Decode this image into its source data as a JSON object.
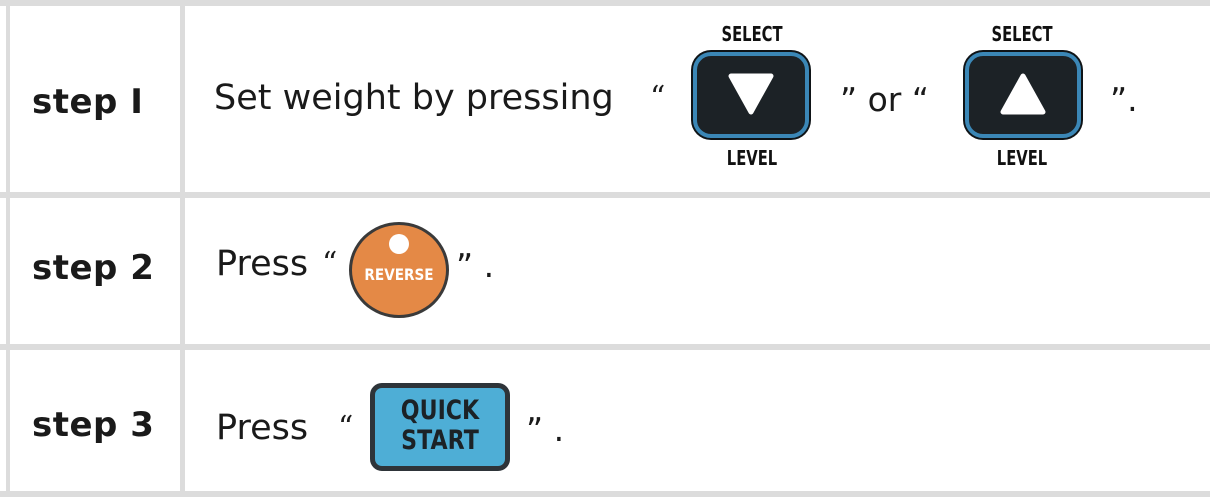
{
  "steps": [
    {
      "label": "step I",
      "text_before": "Set weight by pressing",
      "open_quote_1": "“",
      "close_quote_or": "” or “",
      "close_quote_end": "”.",
      "key_down": {
        "top_caption": "SELECT",
        "bottom_caption": "LEVEL",
        "icon": "triangle-down-icon"
      },
      "key_up": {
        "top_caption": "SELECT",
        "bottom_caption": "LEVEL",
        "icon": "triangle-up-icon"
      }
    },
    {
      "label": "step 2",
      "text_before": "Press",
      "open_quote": "“",
      "close_quote": "” .",
      "button_label": "REVERSE"
    },
    {
      "label": "step 3",
      "text_before": "Press",
      "open_quote": "“",
      "close_quote": "” .",
      "button_line1": "QUICK",
      "button_line2": "START"
    }
  ],
  "colors": {
    "key_fill": "#1c2226",
    "key_border": "#3b87b6",
    "reverse_fill": "#e48946",
    "quick_fill": "#4eaed6",
    "grid": "#dcdcdc"
  }
}
